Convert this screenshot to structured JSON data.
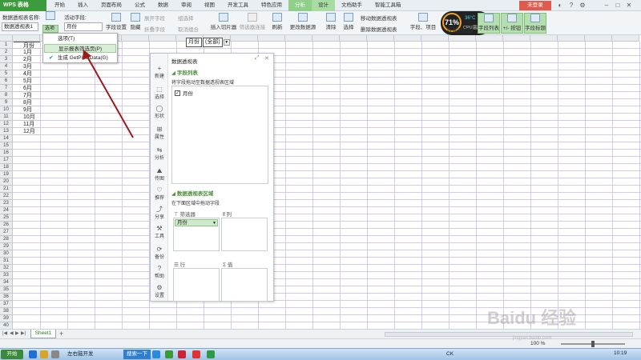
{
  "app": {
    "brand": "WPS 表格",
    "login_label": "未登录"
  },
  "tabs": [
    {
      "label": "开始",
      "state": ""
    },
    {
      "label": "插入",
      "state": ""
    },
    {
      "label": "页面布局",
      "state": ""
    },
    {
      "label": "公式",
      "state": ""
    },
    {
      "label": "数据",
      "state": ""
    },
    {
      "label": "审阅",
      "state": ""
    },
    {
      "label": "视图",
      "state": ""
    },
    {
      "label": "开发工具",
      "state": ""
    },
    {
      "label": "特色应用",
      "state": ""
    },
    {
      "label": "分析",
      "state": "active"
    },
    {
      "label": "设计",
      "state": "green"
    },
    {
      "label": "文档助手",
      "state": ""
    },
    {
      "label": "智能工具箱",
      "state": ""
    }
  ],
  "ribbon": {
    "pivot_name_label": "数据透视表名称:",
    "pivot_name_value": "数据透视表1",
    "options_label": "选项",
    "active_field_label": "活动字段:",
    "active_field_value": "月份",
    "field_settings": "字段设置",
    "hide": "隐藏",
    "expand_field": "展开字段",
    "collapse_field": "折叠字段",
    "group_selection": "组选择",
    "ungroup": "取消组合",
    "insert_slicer": "插入切片器",
    "filter_connections": "筛选器连接",
    "refresh": "刷新",
    "change_source": "更改数据源",
    "clear": "清除",
    "select": "选择",
    "move_pivot": "移动数据透视表",
    "delete_pivot": "删除数据透视表",
    "fields_items": "字段、项目",
    "pivot_chart": "数据透视图",
    "field_list": "字段列表",
    "plus_minus": "+/- 按钮",
    "field_headers": "字段标题"
  },
  "gauge": {
    "percent": "71%",
    "temp": "36°C",
    "label": "CPU温度"
  },
  "sheet": {
    "row_numbers": [
      "1",
      "2",
      "3",
      "4",
      "5",
      "6",
      "7",
      "8",
      "9",
      "10",
      "11",
      "12",
      "13",
      "14",
      "15",
      "16",
      "17",
      "18",
      "19",
      "20",
      "21",
      "22",
      "23",
      "24",
      "25",
      "26",
      "27",
      "28",
      "29",
      "30",
      "31",
      "32",
      "33",
      "34",
      "35",
      "36",
      "37",
      "38",
      "39",
      "40"
    ],
    "month_header": "月份",
    "months": [
      "1月",
      "2月",
      "3月",
      "4月",
      "5月",
      "6月",
      "7月",
      "8月",
      "9月",
      "10月",
      "11月",
      "12月"
    ],
    "filter_field": "月份",
    "filter_value": "(全部)"
  },
  "options_menu": {
    "items": [
      {
        "label": "选项(T)"
      },
      {
        "label": "显示报表筛选页(P)"
      },
      {
        "label": "生成 GetPivotData(G)"
      }
    ]
  },
  "pivot_panel": {
    "title": "数据透视表",
    "sidebar": [
      "新建",
      "选择",
      "形状",
      "属性",
      "分析",
      "传图",
      "推荐",
      "分享",
      "工具",
      "备份",
      "帮助",
      "设置"
    ],
    "field_list_title": "字段列表",
    "field_list_desc": "将字段拖动至数据透视表区域",
    "fields": [
      {
        "label": "月份",
        "checked": true
      }
    ],
    "areas_title": "数据透视表区域",
    "areas_desc": "在下面区域中拖动字段",
    "filter_label": "筛选器",
    "column_label": "列",
    "row_label": "行",
    "value_label": "值",
    "filter_field": "月份"
  },
  "sheet_tabs": [
    {
      "label": "Sheet1"
    }
  ],
  "status": {
    "zoom": "100 %"
  },
  "taskbar": {
    "start": "开始",
    "app_window": "左右脑开发",
    "search": "搜索一下",
    "tray_ck": "CK",
    "clock": "10:19"
  },
  "watermark": {
    "text": "Baidu 经验",
    "sub": "jingyan.baidu.com"
  },
  "colors": {
    "accent_green": "#3d9b3d",
    "selected_tab": "#8fcf8a",
    "arrow": "#9e1a1a"
  }
}
